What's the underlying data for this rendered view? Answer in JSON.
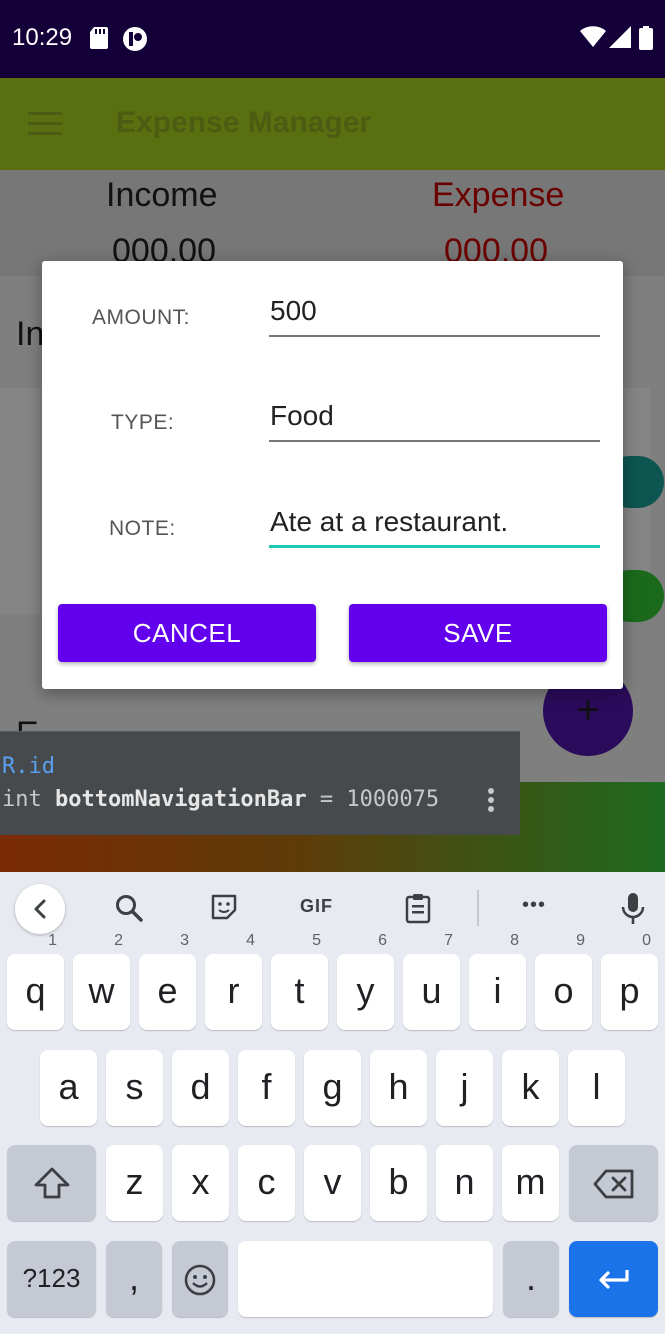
{
  "status_bar": {
    "time": "10:29"
  },
  "app_bar": {
    "title": "Expense Manager"
  },
  "background": {
    "income_label": "Income",
    "income_value": "000.00",
    "expense_label": "Expense",
    "expense_value": "000.00",
    "partial_text_1": "In",
    "partial_text_2": "E",
    "fab_label": "+"
  },
  "tooltip": {
    "line1": "R.id",
    "line2_prefix": "int ",
    "line2_name": "bottomNavigationBar",
    "line2_suffix": " = 1000075"
  },
  "dialog": {
    "amount_label": "AMOUNT:",
    "amount_value": "500",
    "type_label": "TYPE:",
    "type_value": "Food",
    "note_label": "NOTE:",
    "note_value": "Ate at a restaurant.",
    "cancel_label": "CANCEL",
    "save_label": "SAVE"
  },
  "keyboard": {
    "gif_label": "GIF",
    "more_label": "•••",
    "row1": [
      "q",
      "w",
      "e",
      "r",
      "t",
      "y",
      "u",
      "i",
      "o",
      "p"
    ],
    "row1_hints": [
      "1",
      "2",
      "3",
      "4",
      "5",
      "6",
      "7",
      "8",
      "9",
      "0"
    ],
    "row2": [
      "a",
      "s",
      "d",
      "f",
      "g",
      "h",
      "j",
      "k",
      "l"
    ],
    "row3": [
      "z",
      "x",
      "c",
      "v",
      "b",
      "n",
      "m"
    ],
    "symbols_label": "?123",
    "comma_label": ",",
    "period_label": "."
  },
  "colors": {
    "status_bar": "#140038",
    "app_bar": "#5a6f10",
    "button": "#6200ee",
    "focus_underline": "#1ec8b4",
    "enter_key": "#1a73e8"
  }
}
